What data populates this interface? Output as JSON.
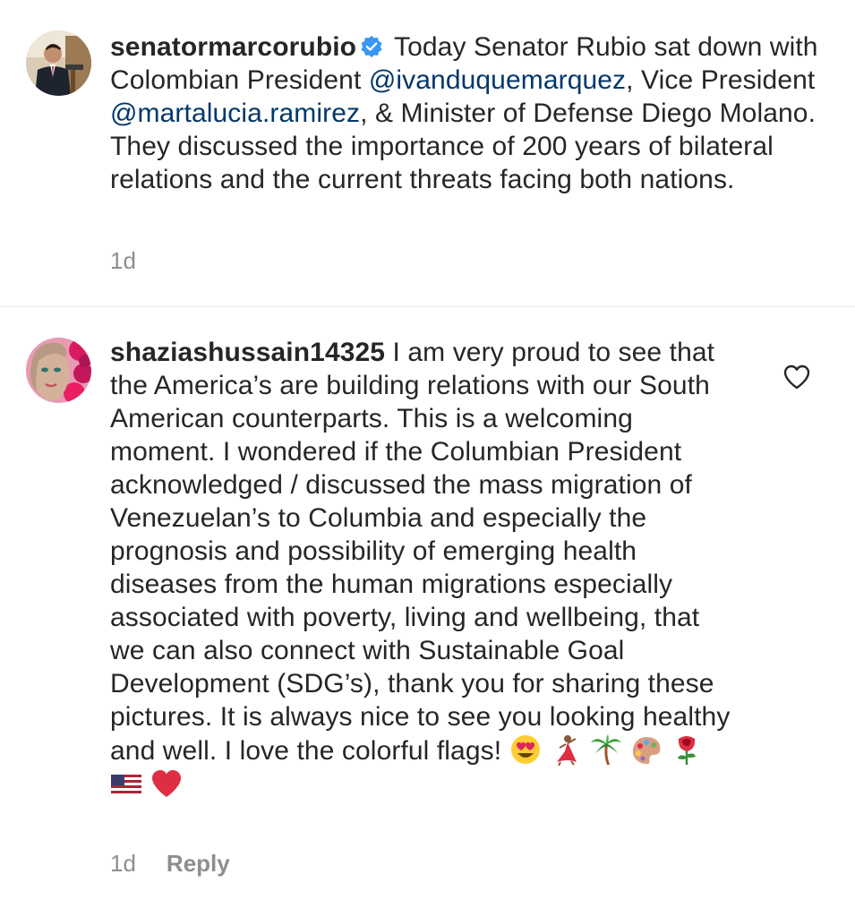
{
  "post": {
    "username": "senatormarcorubio",
    "verified_icon": "verified-badge-icon",
    "caption_part1": " Today Senator Rubio sat down with Colombian President ",
    "mention1": "@ivanduquemarquez",
    "caption_part2": ", Vice President ",
    "mention2": "@martalucia.ramirez",
    "caption_part3": ", & Minister of Defense Diego Molano. They discussed the importance of 200 years of bilateral relations and the current threats facing both nations.",
    "timestamp": "1d"
  },
  "comment": {
    "username": "shaziashussain14325",
    "text": " I am very proud to see that the America’s are building relations with our South American counterparts. This is a welcoming moment. I wondered if the Columbian President acknowledged / discussed the mass migration of Venezuelan’s to Columbia and especially the prognosis and possibility of emerging health diseases from the human migrations especially associated with poverty, living and wellbeing, that we can also connect with Sustainable Goal Development (SDG’s), thank you for sharing these pictures. It is always nice to see you looking healthy and well. I love the colorful flags! ",
    "emojis": [
      "heart-eyes-emoji",
      "dancer-emoji",
      "palm-tree-emoji",
      "palette-emoji",
      "rose-emoji",
      "us-flag-emoji",
      "red-heart-emoji"
    ],
    "timestamp": "1d",
    "reply_label": "Reply",
    "like_icon": "heart-outline-icon"
  },
  "colors": {
    "text": "#262626",
    "mention": "#00376b",
    "secondary": "#8e8e8e",
    "divider": "#e6e6e6",
    "verified": "#3897f0"
  }
}
